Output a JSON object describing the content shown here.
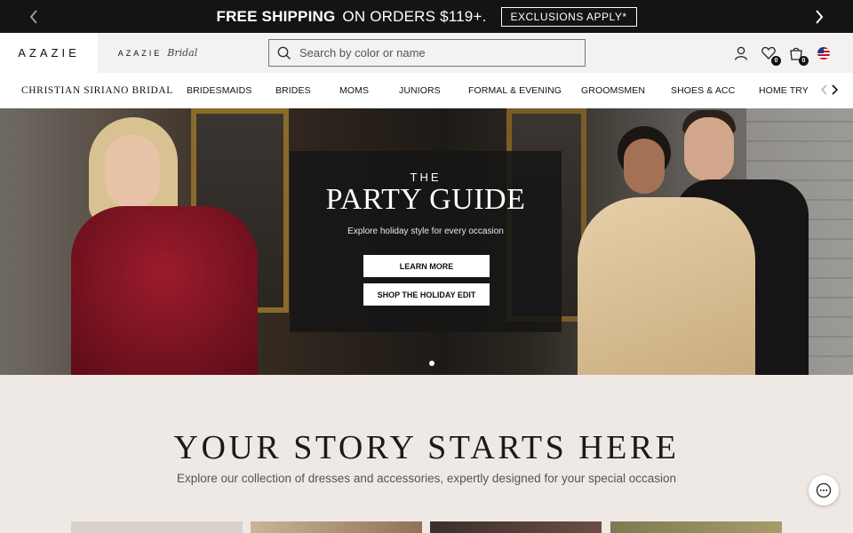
{
  "promo": {
    "bold_text": "FREE SHIPPING",
    "regular_text": "ON ORDERS $119+.",
    "exclusions": "EXCLUSIONS APPLY*",
    "prev_icon": "chevron-left-icon",
    "next_icon": "chevron-right-icon"
  },
  "header": {
    "brand": "AZAZIE",
    "bridal_word": "AZAZIE",
    "bridal_script": "Bridal",
    "search_placeholder": "Search by color or name",
    "wishlist_count": "0",
    "cart_count": "0"
  },
  "nav": {
    "items": [
      "CHRISTIAN SIRIANO BRIDAL",
      "BRIDESMAIDS",
      "BRIDES",
      "MOMS",
      "JUNIORS",
      "FORMAL & EVENING",
      "GROOMSMEN",
      "SHOES & ACC",
      "HOME TRY C"
    ]
  },
  "hero": {
    "kicker": "THE",
    "title": "PARTY GUIDE",
    "subtitle": "Explore holiday style for every occasion",
    "learn_more": "LEARN MORE",
    "shop_edit": "SHOP THE HOLIDAY EDIT"
  },
  "story": {
    "title": "YOUR STORY STARTS HERE",
    "subtitle": "Explore our collection of dresses and accessories, expertly designed for your special occasion"
  },
  "colors": {
    "promo_bg": "#141414",
    "page_bg": "#efe9e6",
    "accent": "#111111"
  }
}
